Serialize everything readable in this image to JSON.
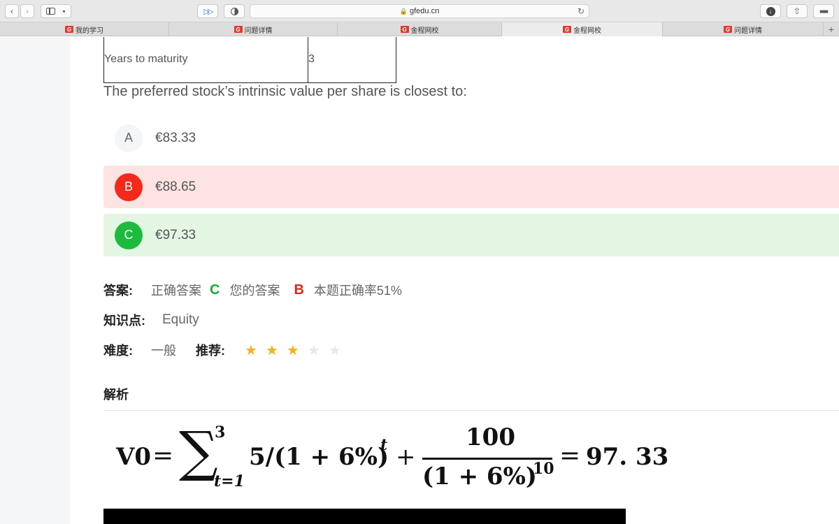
{
  "browser": {
    "url": "gfedu.cn",
    "tabs": [
      {
        "label": "我的学习",
        "favicon": "gfedu-icon"
      },
      {
        "label": "问题详情",
        "favicon": "gfedu-icon"
      },
      {
        "label": "金程网校",
        "favicon": "gfedu-icon"
      },
      {
        "label": "金程网校",
        "favicon": "gfedu-icon",
        "active": true
      },
      {
        "label": "问题详情",
        "favicon": "gfedu-icon"
      }
    ]
  },
  "table": {
    "rows": [
      {
        "label": "Years to maturity",
        "value": "3"
      }
    ]
  },
  "question": "The preferred stock’s intrinsic value per share is closest to:",
  "options": [
    {
      "letter": "A",
      "text": "€83.33",
      "state": "neutral"
    },
    {
      "letter": "B",
      "text": "€88.65",
      "state": "wrong"
    },
    {
      "letter": "C",
      "text": "€97.33",
      "state": "correct"
    }
  ],
  "answer": {
    "label": "答案:",
    "correct_label": "正确答案",
    "correct": "C",
    "yours_label": "您的答案",
    "yours": "B",
    "rate": "本题正确率51%"
  },
  "knowledge": {
    "label": "知识点:",
    "value": "Equity"
  },
  "difficulty": {
    "label": "难度:",
    "value": "一般",
    "recommend_label": "推荐:",
    "stars": 3,
    "max_stars": 5
  },
  "analysis": {
    "title": "解析",
    "formula": {
      "lhs": "V0",
      "eq": "=",
      "sum_upper": "3",
      "sum_lower": "t=1",
      "term": "5/(1 + 6%)",
      "term_exp": "t",
      "plus": "+",
      "numerator": "100",
      "denominator": "(1 + 6%)",
      "den_exp": "10",
      "eq2": "=",
      "result": "97. 33"
    }
  },
  "colors": {
    "wrong_bg": "#fde4e2",
    "correct_bg": "#e3f6e4",
    "wrong_accent": "#f2291b",
    "correct_accent": "#1dbb3d",
    "star_on": "#f4b120",
    "star_off": "#e6e8ec",
    "brand": "#e3382f"
  }
}
